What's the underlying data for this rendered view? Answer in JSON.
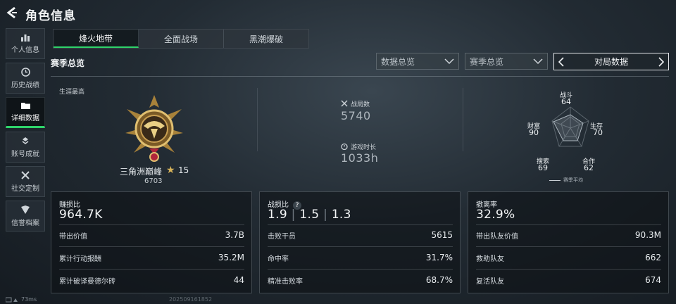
{
  "header": {
    "title": "角色信息"
  },
  "sidebar": {
    "items": [
      {
        "label": "个人信息",
        "icon": "bar-chart-icon"
      },
      {
        "label": "历史战绩",
        "icon": "clock-icon"
      },
      {
        "label": "详细数据",
        "icon": "folder-icon"
      },
      {
        "label": "账号成就",
        "icon": "achievement-icon"
      },
      {
        "label": "社交定制",
        "icon": "tools-icon"
      },
      {
        "label": "信誉档案",
        "icon": "shield-icon"
      }
    ]
  },
  "tabs": [
    "烽火地带",
    "全面战场",
    "黑潮爆破"
  ],
  "season": {
    "title": "赛季总览"
  },
  "selectors": {
    "data_overview": "数据总览",
    "season_overview": "赛季总览",
    "match_data": "对局数据"
  },
  "overview": {
    "career_label": "生涯最高",
    "rank_name": "三角洲巅峰",
    "rank_stars": "15",
    "rank_points": "6703",
    "matches_label": "战局数",
    "matches_value": "5740",
    "time_label": "游戏时长",
    "time_value": "1033h"
  },
  "radar": {
    "combat": {
      "label": "战斗",
      "value": "64"
    },
    "survival": {
      "label": "生存",
      "value": "70"
    },
    "cooperation": {
      "label": "合作",
      "value": "62"
    },
    "search": {
      "label": "搜索",
      "value": "69"
    },
    "wealth": {
      "label": "财富",
      "value": "90"
    },
    "legend": "赛季平均"
  },
  "cards": [
    {
      "header": "赚损比",
      "big": "964.7K",
      "rows": [
        {
          "label": "带出价值",
          "value": "3.7B"
        },
        {
          "label": "累计行动报酬",
          "value": "35.2M"
        },
        {
          "label": "累计破译曼德尔砖",
          "value": "44"
        }
      ]
    },
    {
      "header": "战损比",
      "help": "?",
      "bigparts": [
        "1.9",
        "1.5",
        "1.3"
      ],
      "rows": [
        {
          "label": "击败干员",
          "value": "5615"
        },
        {
          "label": "命中率",
          "value": "31.7%"
        },
        {
          "label": "精准击败率",
          "value": "68.7%"
        }
      ]
    },
    {
      "header": "撤离率",
      "big": "32.9%",
      "rows": [
        {
          "label": "带出队友价值",
          "value": "90.3M"
        },
        {
          "label": "救助队友",
          "value": "662"
        },
        {
          "label": "复活队友",
          "value": "674"
        }
      ]
    }
  ],
  "footer": {
    "ping": "73ms",
    "uid": "202509161852"
  },
  "colors": {
    "accent": "#2fd36a",
    "rank_gold": "#d8b45a"
  }
}
